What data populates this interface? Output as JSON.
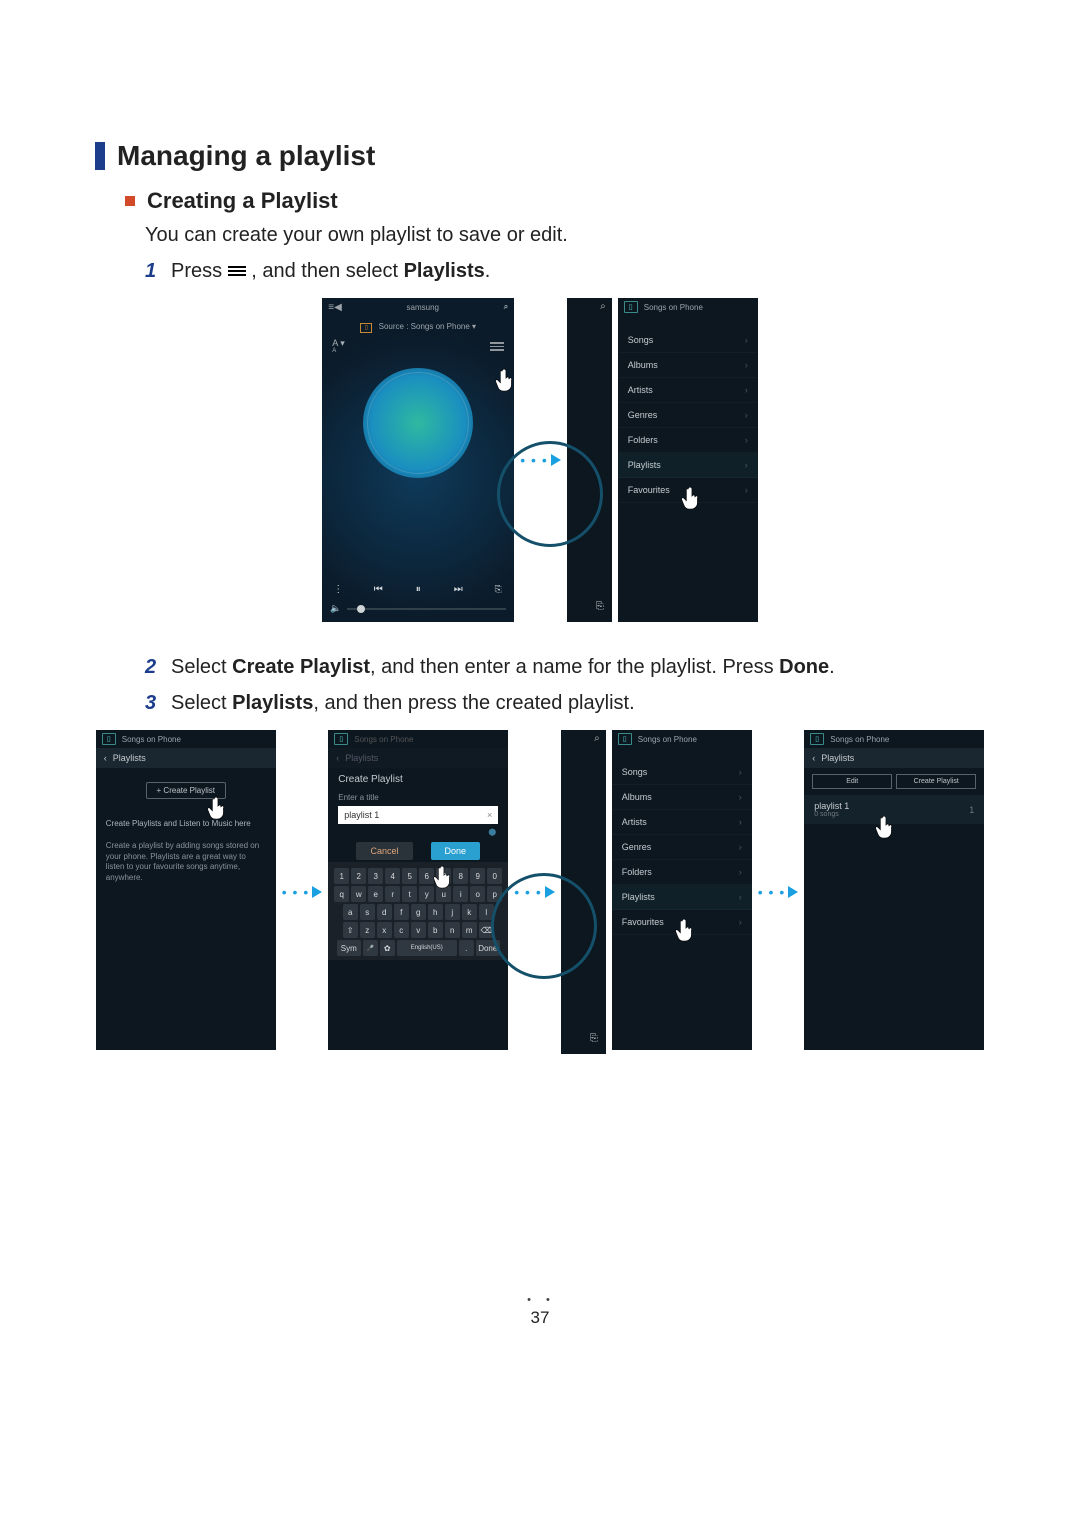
{
  "headings": {
    "h1": "Managing a playlist",
    "h2": "Creating a Playlist"
  },
  "body": {
    "intro": "You can create your own playlist to save or edit."
  },
  "steps": {
    "s1_a": "Press ",
    "s1_b": ", and then select ",
    "s1_playlists": "Playlists",
    "s1_c": ".",
    "s2_a": "Select ",
    "s2_cp": "Create Playlist",
    "s2_b": ", and then enter a name for the playlist. Press ",
    "s2_done": "Done",
    "s2_c": ".",
    "s3_a": "Select ",
    "s3_pl": "Playlists",
    "s3_b": ", and then press the created playlist."
  },
  "screens": {
    "player": {
      "brand": "samsung",
      "source_prefix": "Source : ",
      "source": "Songs on Phone",
      "alphaMain": "A",
      "alphaSub": "A"
    },
    "songs_on_phone_title": "Songs on Phone",
    "menu_items": [
      "Songs",
      "Albums",
      "Artists",
      "Genres",
      "Folders",
      "Playlists",
      "Favourites"
    ],
    "playlists_crumb": "Playlists",
    "cp_btn": "+ Create Playlist",
    "cp_help_line1": "Create Playlists and Listen to Music here",
    "cp_help_line2": "Create a playlist by adding songs stored on your phone. Playlists are a great way to listen to your favourite songs anytime, anywhere.",
    "kb": {
      "title": "Create Playlist",
      "enter_title": "Enter a title",
      "value": "playlist 1",
      "cancel": "Cancel",
      "done": "Done",
      "row1": [
        "1",
        "2",
        "3",
        "4",
        "5",
        "6",
        "7",
        "8",
        "9",
        "0"
      ],
      "row2": [
        "q",
        "w",
        "e",
        "r",
        "t",
        "y",
        "u",
        "i",
        "o",
        "p"
      ],
      "row3": [
        "a",
        "s",
        "d",
        "f",
        "g",
        "h",
        "j",
        "k",
        "l"
      ],
      "row4": [
        "⇧",
        "z",
        "x",
        "c",
        "v",
        "b",
        "n",
        "m",
        "⌫"
      ],
      "row5_sym": "Sym",
      "row5_mic": "🎤",
      "row5_gear": "✿",
      "row5_lang": "English(US)",
      "row5_dot": ".",
      "row5_done": "Done"
    },
    "last": {
      "edit": "Edit",
      "create": "Create Playlist",
      "item_name": "playlist 1",
      "item_sub": "0 songs",
      "item_count": "1"
    }
  },
  "page_number": "37"
}
